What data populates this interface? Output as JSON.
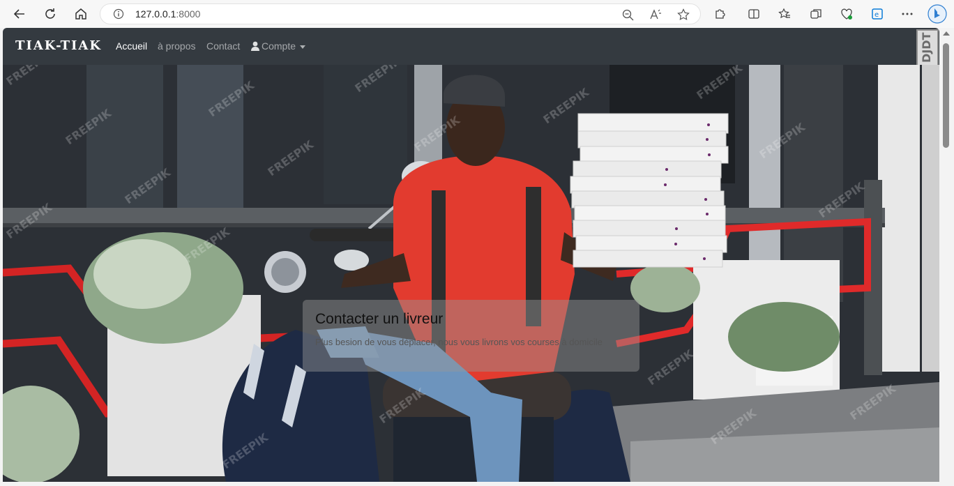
{
  "browser": {
    "url_host": "127.0.0.1",
    "url_port": ":8000",
    "icons": {
      "back": "back-arrow-icon",
      "refresh": "refresh-icon",
      "home": "home-icon",
      "info": "info-icon",
      "zoom": "zoom-out-icon",
      "read_aloud": "read-aloud-icon",
      "favorite": "star-icon",
      "extensions": "puzzle-icon",
      "split": "split-screen-icon",
      "favorites_list": "favorites-icon",
      "collections": "collections-icon",
      "performance": "heart-pulse-icon",
      "edge": "edge-icon",
      "more": "more-dots-icon",
      "bing": "bing-icon"
    }
  },
  "navbar": {
    "brand": "TIAK-TIAK",
    "links": [
      {
        "label": "Accueil",
        "active": true
      },
      {
        "label": "à propos",
        "active": false
      },
      {
        "label": "Contact",
        "active": false
      }
    ],
    "account_label": "Compte",
    "extension_badge": "DJDT",
    "background": "#343a40"
  },
  "hero": {
    "title": "Contacter un livreur",
    "subtitle": "Plus besion de vous déplacer, nous vous livrons vos courses à domicile",
    "watermark": "FREEPIK"
  }
}
